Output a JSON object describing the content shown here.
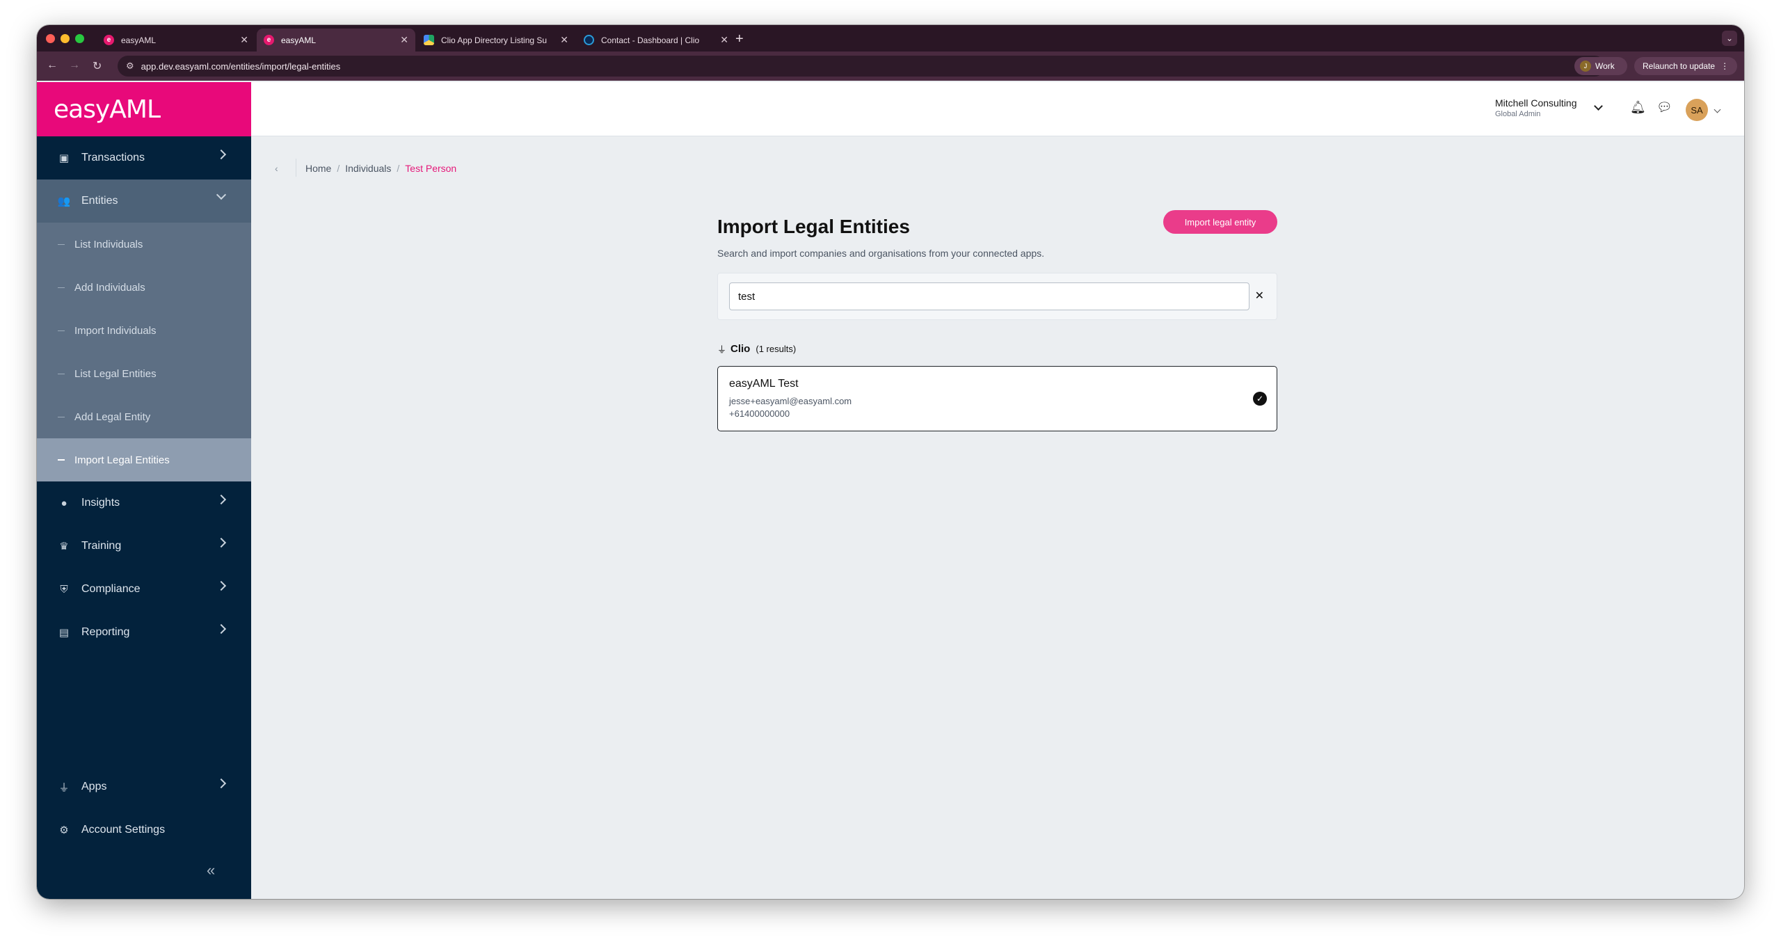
{
  "browser": {
    "tabs": [
      {
        "title": "easyAML",
        "icon": "easyaml-favicon"
      },
      {
        "title": "easyAML",
        "icon": "easyaml-favicon"
      },
      {
        "title": "Clio App Directory Listing Su",
        "icon": "google-drive-favicon"
      },
      {
        "title": "Contact - Dashboard | Clio",
        "icon": "clio-favicon"
      }
    ],
    "url": "app.dev.easyaml.com/entities/import/legal-entities",
    "profile_initial": "J",
    "profile_label": "Work",
    "relaunch_label": "Relaunch to update"
  },
  "app": {
    "logo": "easyAML",
    "sidebar": {
      "items": [
        {
          "label": "Transactions"
        },
        {
          "label": "Entities"
        },
        {
          "label": "Insights"
        },
        {
          "label": "Training"
        },
        {
          "label": "Compliance"
        },
        {
          "label": "Reporting"
        },
        {
          "label": "Apps"
        },
        {
          "label": "Account Settings"
        }
      ],
      "entities_sub": [
        {
          "label": "List Individuals"
        },
        {
          "label": "Add Individuals"
        },
        {
          "label": "Import Individuals"
        },
        {
          "label": "List Legal Entities"
        },
        {
          "label": "Add Legal Entity"
        },
        {
          "label": "Import Legal Entities"
        }
      ]
    },
    "topbar": {
      "org_name": "Mitchell Consulting",
      "org_role": "Global Admin",
      "avatar_initials": "SA"
    },
    "breadcrumb": [
      "Home",
      "Individuals",
      "Test Person"
    ],
    "page": {
      "title": "Import Legal Entities",
      "subtitle": "Search and import companies and organisations from your connected apps.",
      "import_button": "Import legal entity",
      "search_value": "test",
      "source_name": "Clio",
      "source_count": "(1 results)",
      "results": [
        {
          "name": "easyAML Test",
          "email": "jesse+easyaml@easyaml.com",
          "phone": "+61400000000"
        }
      ]
    }
  },
  "colors": {
    "brand": "#e8097a",
    "sidebar_bg": "#03223c",
    "button": "#ea3c8a"
  }
}
